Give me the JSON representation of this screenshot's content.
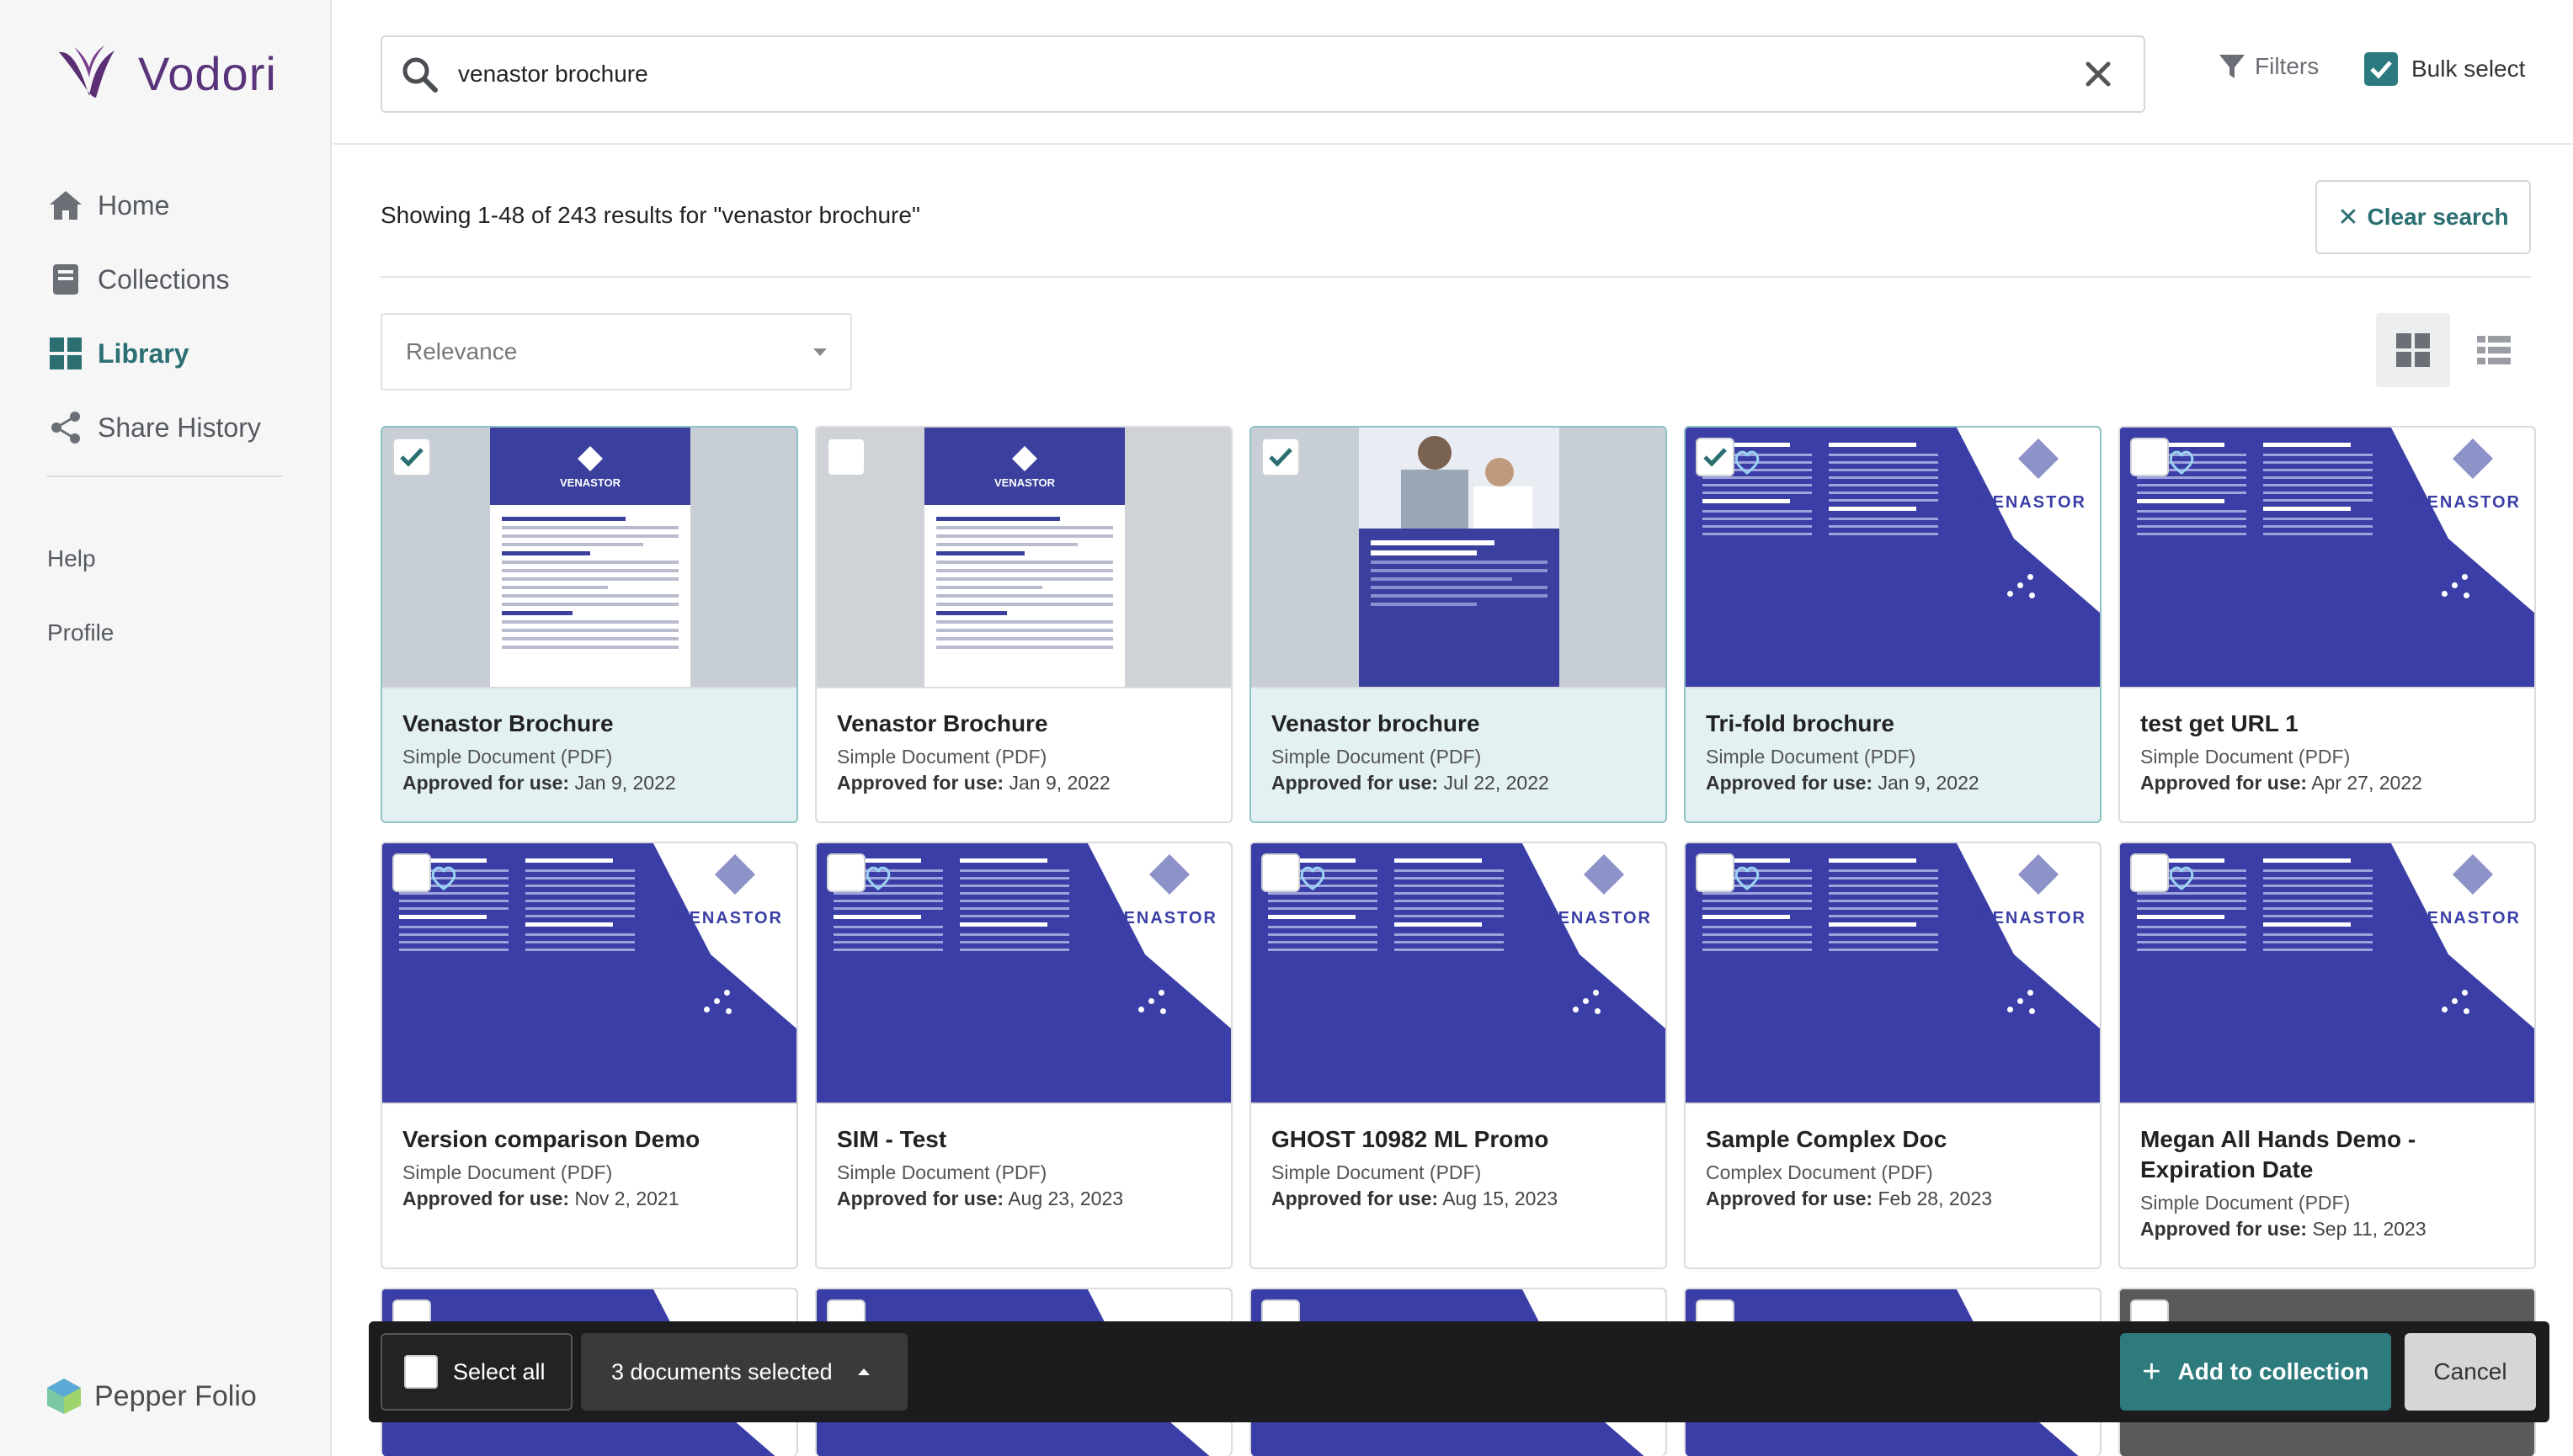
{
  "sidebar": {
    "logo_text": "Vodori",
    "nav": [
      {
        "label": "Home",
        "icon": "home-icon"
      },
      {
        "label": "Collections",
        "icon": "book-icon"
      },
      {
        "label": "Library",
        "icon": "grid-icon",
        "active": true
      },
      {
        "label": "Share History",
        "icon": "share-icon"
      }
    ],
    "subnav": [
      {
        "label": "Help"
      },
      {
        "label": "Profile"
      }
    ],
    "brand_bottom": "Pepper Folio"
  },
  "topbar": {
    "search_value": "venastor brochure",
    "filters_label": "Filters",
    "bulk_select_label": "Bulk select",
    "bulk_select_checked": true
  },
  "results": {
    "summary": "Showing 1-48 of 243 results for \"venastor brochure\"",
    "clear_search_label": "Clear search",
    "sort_value": "Relevance"
  },
  "thumb_text": {
    "brand": "VENASTOR"
  },
  "cards": [
    {
      "title": "Venastor Brochure",
      "type": "Simple Document (PDF)",
      "approved_label": "Approved for use:",
      "approved_date": "Jan 9, 2022",
      "selected": true
    },
    {
      "title": "Venastor Brochure",
      "type": "Simple Document (PDF)",
      "approved_label": "Approved for use:",
      "approved_date": "Jan 9, 2022",
      "selected": false
    },
    {
      "title": "Venastor brochure",
      "type": "Simple Document (PDF)",
      "approved_label": "Approved for use:",
      "approved_date": "Jul 22, 2022",
      "selected": true
    },
    {
      "title": "Tri-fold brochure",
      "type": "Simple Document (PDF)",
      "approved_label": "Approved for use:",
      "approved_date": "Jan 9, 2022",
      "selected": true
    },
    {
      "title": "test get URL 1",
      "type": "Simple Document (PDF)",
      "approved_label": "Approved for use:",
      "approved_date": "Apr 27, 2022",
      "selected": false
    },
    {
      "title": "Version comparison Demo",
      "type": "Simple Document (PDF)",
      "approved_label": "Approved for use:",
      "approved_date": "Nov 2, 2021",
      "selected": false
    },
    {
      "title": "SIM - Test",
      "type": "Simple Document (PDF)",
      "approved_label": "Approved for use:",
      "approved_date": "Aug 23, 2023",
      "selected": false
    },
    {
      "title": "GHOST 10982 ML Promo",
      "type": "Simple Document (PDF)",
      "approved_label": "Approved for use:",
      "approved_date": "Aug 15, 2023",
      "selected": false
    },
    {
      "title": "Sample Complex Doc",
      "type": "Complex Document (PDF)",
      "approved_label": "Approved for use:",
      "approved_date": "Feb 28, 2023",
      "selected": false
    },
    {
      "title": "Megan All Hands Demo - Expiration Date",
      "type": "Simple Document (PDF)",
      "approved_label": "Approved for use:",
      "approved_date": "Sep 11, 2023",
      "selected": false
    }
  ],
  "bottombar": {
    "select_all_label": "Select all",
    "selected_count_label": "3 documents selected",
    "add_label": "Add to collection",
    "cancel_label": "Cancel"
  },
  "colors": {
    "accent": "#2b6f73",
    "brand_purple": "#59347a",
    "doc_blue": "#3a3ea6"
  }
}
